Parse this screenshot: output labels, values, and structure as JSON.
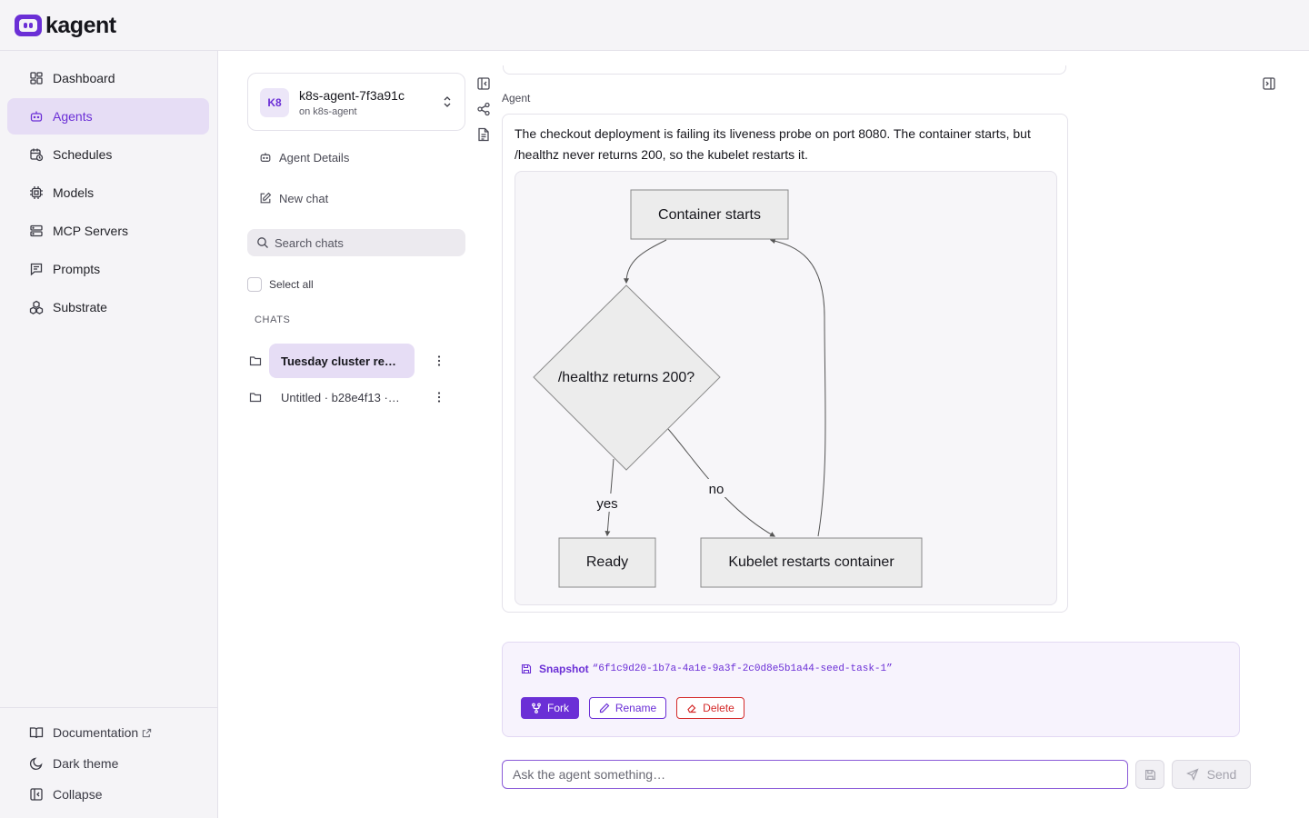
{
  "app": {
    "brand": "kagent",
    "accent": "#6b2fd6"
  },
  "sidebar": {
    "items": [
      {
        "label": "Dashboard",
        "icon": "dashboard-icon"
      },
      {
        "label": "Agents",
        "icon": "bot-icon",
        "active": true
      },
      {
        "label": "Schedules",
        "icon": "calendar-clock-icon"
      },
      {
        "label": "Models",
        "icon": "chip-icon"
      },
      {
        "label": "MCP Servers",
        "icon": "server-icon"
      },
      {
        "label": "Prompts",
        "icon": "message-square-icon"
      },
      {
        "label": "Substrate",
        "icon": "boxes-icon"
      }
    ],
    "footer": {
      "documentation": "Documentation",
      "dark_theme": "Dark theme",
      "collapse": "Collapse"
    }
  },
  "agent": {
    "initials": "K8",
    "name": "k8s-agent-7f3a91c",
    "subtitle": "on k8s-agent"
  },
  "chat_panel": {
    "agent_details": "Agent Details",
    "new_chat": "New chat",
    "search_placeholder": "Search chats",
    "select_all": "Select all",
    "section_label": "CHATS",
    "chats": [
      {
        "title": "Tuesday cluster re…",
        "active": true
      },
      {
        "title": "Untitled · b28e4f13 ·…",
        "active": false
      }
    ]
  },
  "conversation": {
    "role_label": "Agent",
    "message": "The checkout deployment is failing its liveness probe on port 8080. The container starts, but /healthz never returns 200, so the kubelet restarts it.",
    "diagram": {
      "nodes": {
        "start": "Container starts",
        "decision": "/healthz returns 200?",
        "ready": "Ready",
        "restart": "Kubelet restarts container"
      },
      "edges": {
        "yes": "yes",
        "no": "no"
      }
    }
  },
  "snapshot": {
    "title": "Snapshot",
    "id": "“6f1c9d20-1b7a-4a1e-9a3f-2c0d8e5b1a44-seed-task-1”",
    "fork": "Fork",
    "rename": "Rename",
    "delete": "Delete"
  },
  "composer": {
    "placeholder": "Ask the agent something…",
    "send": "Send"
  }
}
